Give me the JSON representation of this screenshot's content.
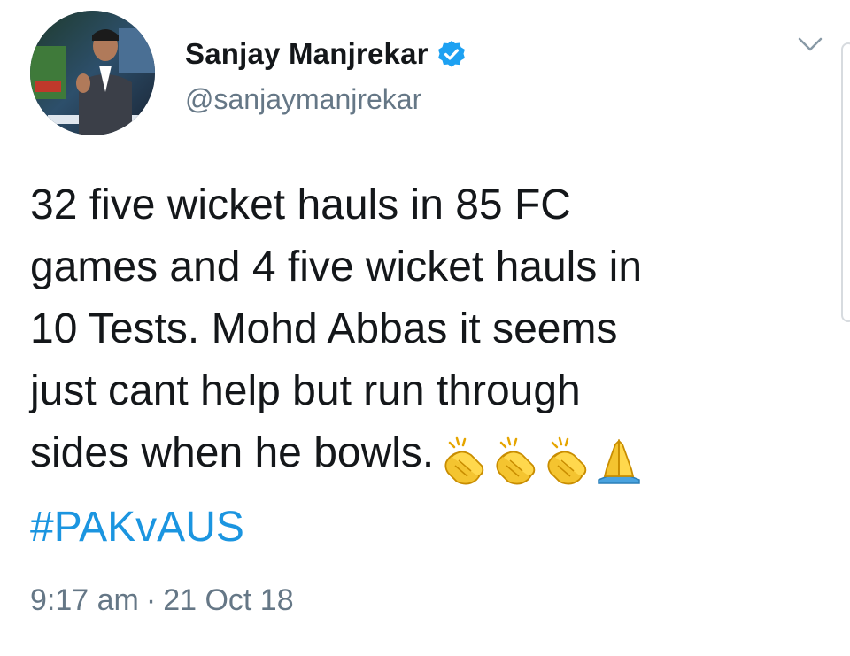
{
  "user": {
    "display_name": "Sanjay Manjrekar",
    "handle": "@sanjaymanjrekar",
    "verified": true,
    "avatar_icon": "profile-photo"
  },
  "tweet": {
    "text": "32 five wicket hauls in 85 FC\ngames and 4 five wicket hauls in\n10 Tests. Mohd Abbas it seems\njust cant help but run through\nsides when he bowls.",
    "emojis": [
      "clapping-hands-icon",
      "clapping-hands-icon",
      "clapping-hands-icon",
      "folded-hands-icon"
    ],
    "hashtag": "#PAKvAUS",
    "time": "9:17 am",
    "separator": "·",
    "date": "21 Oct 18"
  },
  "icons": {
    "menu": "chevron-down-icon",
    "verified": "verified-badge-icon"
  },
  "colors": {
    "text": "#14171a",
    "secondary": "#657786",
    "link": "#1b95e0",
    "verified": "#1da1f2"
  }
}
